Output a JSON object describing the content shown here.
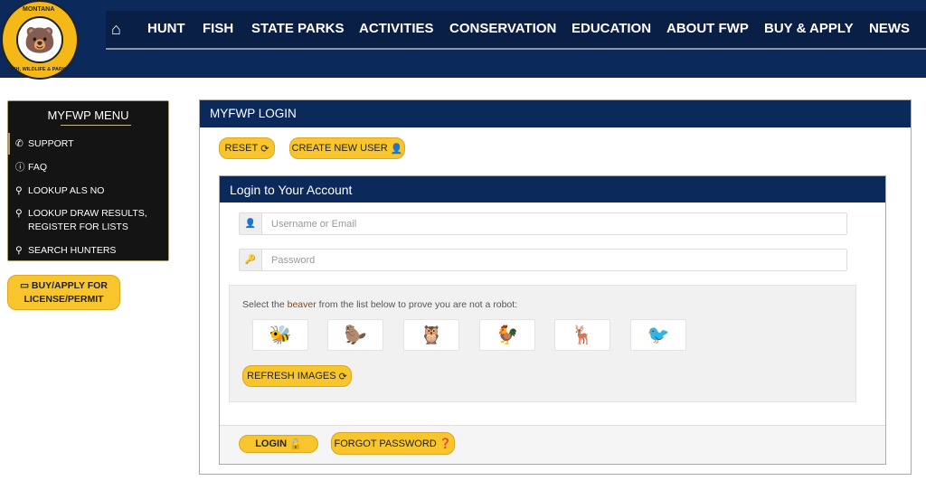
{
  "logo": {
    "text_top": "MONTANA",
    "text_bottom": "FISH, WILDLIFE & PARKS"
  },
  "nav": {
    "home_icon": "home-icon",
    "items": [
      "HUNT",
      "FISH",
      "STATE PARKS",
      "ACTIVITIES",
      "CONSERVATION",
      "EDUCATION",
      "ABOUT FWP",
      "BUY & APPLY",
      "NEWS"
    ]
  },
  "sidebar": {
    "title": "MYFWP MENU",
    "items": [
      {
        "label": "SUPPORT",
        "icon": "phone-icon"
      },
      {
        "label": "FAQ",
        "icon": "question-circle-icon"
      },
      {
        "label": "LOOKUP ALS NO",
        "icon": "search-icon"
      },
      {
        "label": "LOOKUP DRAW RESULTS,",
        "label2": "REGISTER FOR LISTS",
        "icon": "search-icon"
      },
      {
        "label": "SEARCH HUNTERS",
        "icon": "search-icon"
      }
    ],
    "buy_button": {
      "line1": "BUY/APPLY FOR",
      "line2": "LICENSE/PERMIT",
      "icon": "credit-card-icon"
    }
  },
  "main": {
    "title": "MYFWP LOGIN",
    "reset_label": "RESET",
    "create_user_label": "CREATE NEW USER",
    "card": {
      "title": "Login to Your Account",
      "username_placeholder": "Username or Email",
      "password_placeholder": "Password",
      "captcha": {
        "prefix": "Select the ",
        "target": "beaver",
        "suffix": " from the list below to prove you are not a robot:",
        "animals": [
          "bee",
          "beaver",
          "owl",
          "pheasant",
          "deer",
          "woodpecker"
        ],
        "refresh_label": "REFRESH IMAGES"
      },
      "login_label": "LOGIN",
      "forgot_label": "FORGOT PASSWORD"
    }
  },
  "colors": {
    "navy": "#0b2a5b",
    "accent_yellow": "#f8c52c",
    "menu_bg": "#141414"
  }
}
